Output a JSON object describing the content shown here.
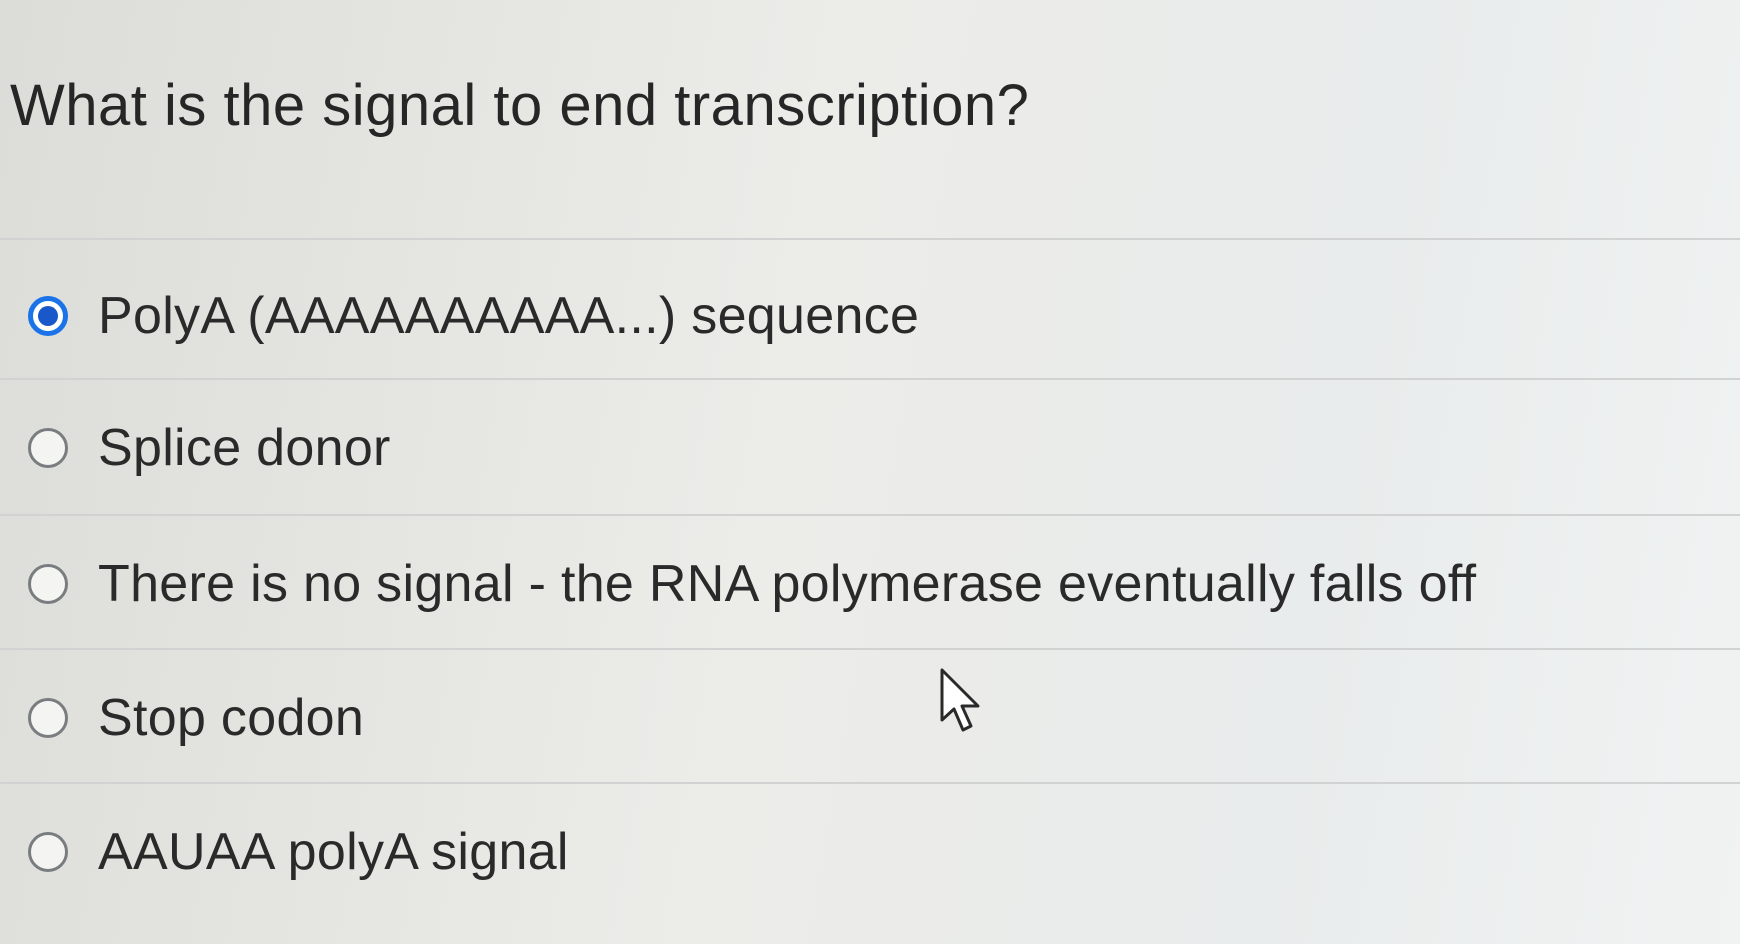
{
  "question": {
    "text": "What is the signal to end transcription?"
  },
  "options": [
    {
      "label": "PolyA (AAAAAAAAAA...) sequence",
      "selected": true
    },
    {
      "label": "Splice donor",
      "selected": false
    },
    {
      "label": "There is no signal - the RNA polymerase eventually falls off",
      "selected": false
    },
    {
      "label": "Stop codon",
      "selected": false
    },
    {
      "label": "AAUAA polyA signal",
      "selected": false
    }
  ],
  "icons": {
    "cursor": "mouse-pointer-icon"
  },
  "colors": {
    "accent": "#1a73e8",
    "radio_border": "#7a7d80",
    "text": "#2a2a2a"
  }
}
